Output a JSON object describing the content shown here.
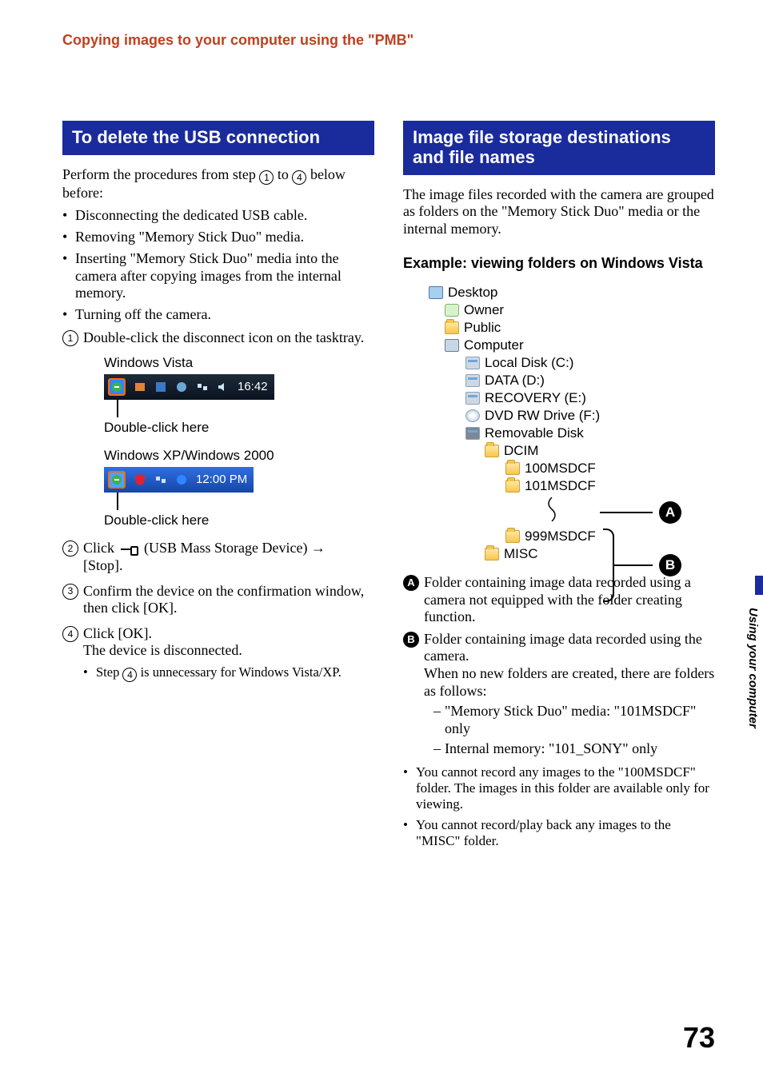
{
  "running_head": "Copying images to your computer using the \"PMB\"",
  "side_tab": "Using your computer",
  "page_number": "73",
  "left": {
    "band": "To delete the USB connection",
    "intro_pre": "Perform the procedures from step ",
    "intro_mid": " to ",
    "intro_post": " below before:",
    "step_from": "1",
    "step_to": "4",
    "bullets": [
      "Disconnecting the dedicated USB cable.",
      "Removing \"Memory Stick Duo\" media.",
      "Inserting \"Memory Stick Duo\" media into the camera after copying images from the internal memory.",
      "Turning off the camera."
    ],
    "steps": {
      "s1": "Double-click the disconnect icon on the tasktray.",
      "vista_label": "Windows Vista",
      "vista_time": "16:42",
      "vista_caption": "Double-click here",
      "xp_label": "Windows XP/Windows 2000",
      "xp_time": "12:00 PM",
      "xp_caption": "Double-click here",
      "s2_pre": "Click ",
      "s2_post": " (USB Mass Storage Device) ",
      "s2_tail": "[Stop].",
      "s3": "Confirm the device on the confirmation window, then click [OK].",
      "s4_a": "Click [OK].",
      "s4_b": "The device is disconnected.",
      "s4_note_pre": "Step ",
      "s4_note_num": "4",
      "s4_note_post": " is unnecessary for Windows Vista/XP."
    }
  },
  "right": {
    "band": "Image file storage destinations and file names",
    "intro": "The image files recorded with the camera are grouped as folders on the \"Memory Stick Duo\" media or the internal memory.",
    "example_heading": "Example: viewing folders on Windows Vista",
    "tree": {
      "desktop": "Desktop",
      "owner": "Owner",
      "public": "Public",
      "computer": "Computer",
      "c": "Local Disk (C:)",
      "d": "DATA (D:)",
      "e": "RECOVERY (E:)",
      "f": "DVD RW Drive (F:)",
      "removable": "Removable Disk",
      "dcim": "DCIM",
      "f100": "100MSDCF",
      "f101": "101MSDCF",
      "f999": "999MSDCF",
      "misc": "MISC"
    },
    "callout_a": "A",
    "callout_b": "B",
    "legend": {
      "a": "Folder containing image data recorded using a camera not equipped with the folder creating function.",
      "b1": "Folder containing image data recorded using the camera.",
      "b2": "When no new folders are created, there are folders as follows:",
      "b_dash1": "\"Memory Stick Duo\" media: \"101MSDCF\" only",
      "b_dash2": "Internal memory: \"101_SONY\" only"
    },
    "notes": [
      "You cannot record any images to the \"100MSDCF\" folder. The images in this folder are available only for viewing.",
      "You cannot record/play back any images to the \"MISC\" folder."
    ]
  }
}
